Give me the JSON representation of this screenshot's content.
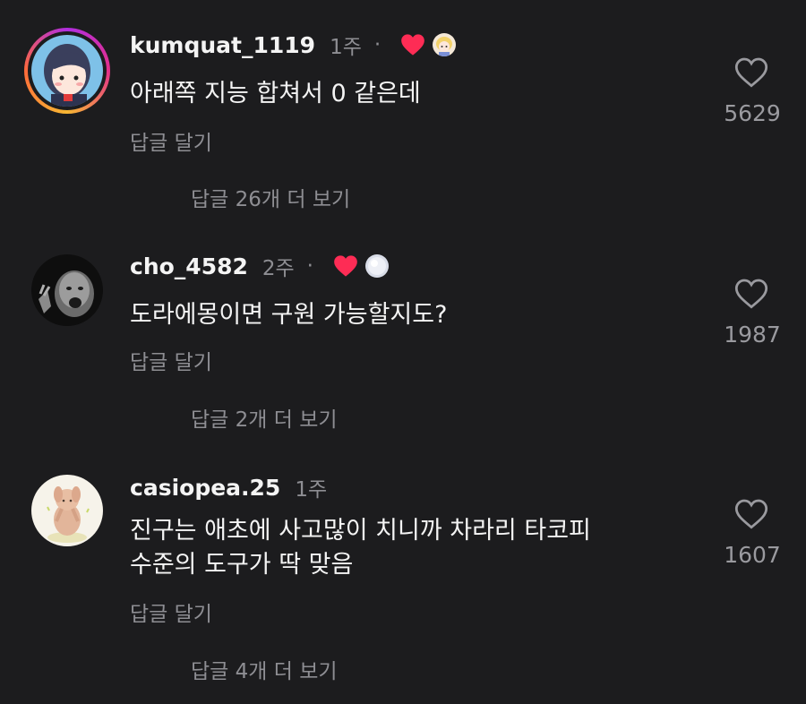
{
  "comments": [
    {
      "username": "kumquat_1119",
      "time": "1주",
      "dot": "·",
      "text_lines": [
        "아래쪽 지능 합쳐서 0 같은데"
      ],
      "reply_label": "답글 달기",
      "view_replies": "답글 26개 더 보기",
      "like_count": "5629",
      "liked_by_creator": true
    },
    {
      "username": "cho_4582",
      "time": "2주",
      "dot": "·",
      "text_lines": [
        "도라에몽이면 구원 가능할지도?"
      ],
      "reply_label": "답글 달기",
      "view_replies": "답글 2개 더 보기",
      "like_count": "1987",
      "liked_by_creator": true
    },
    {
      "username": "casiopea.25",
      "time": "1주",
      "text_lines": [
        "진구는 애초에 사고많이 치니까 차라리 타코피",
        "수준의 도구가 딱 맞음"
      ],
      "reply_label": "답글 달기",
      "view_replies": "답글 4개 더 보기",
      "like_count": "1607",
      "liked_by_creator": false
    }
  ],
  "colors": {
    "background": "#1c1c1e",
    "text_primary": "#f4f4f4",
    "text_secondary": "#8e8e93",
    "heart_red": "#fe2c55"
  },
  "icons": {
    "like": "heart-outline-icon",
    "creator_like": "heart-filled-icon"
  }
}
